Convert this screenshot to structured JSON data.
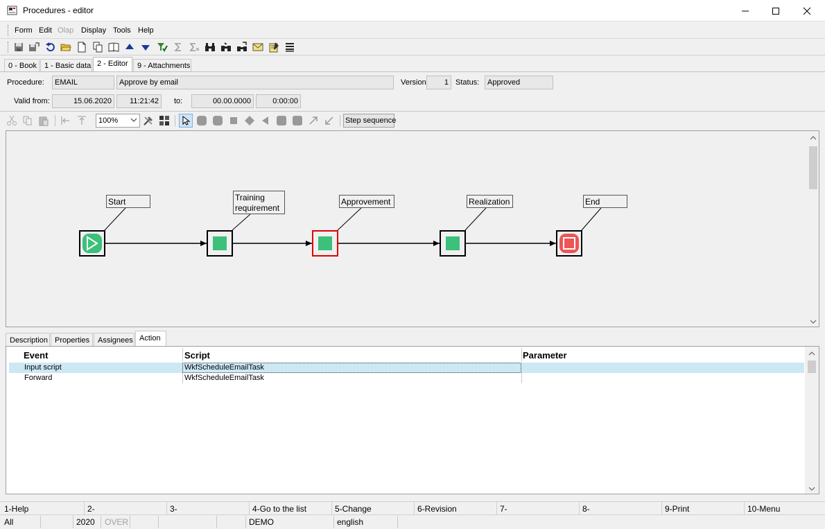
{
  "window": {
    "title": "Procedures - editor"
  },
  "menu": [
    {
      "label": "Form",
      "enabled": true
    },
    {
      "label": "Edit",
      "enabled": true
    },
    {
      "label": "Olap",
      "enabled": false
    },
    {
      "label": "Display",
      "enabled": true
    },
    {
      "label": "Tools",
      "enabled": true
    },
    {
      "label": "Help",
      "enabled": true
    }
  ],
  "toolbar_icons": [
    "save-icon",
    "save-as-icon",
    "undo-icon",
    "open-folder-icon",
    "new-document-icon",
    "copy-document-icon",
    "book-icon",
    "arrow-up-icon",
    "arrow-down-icon",
    "filter-check-icon",
    "sum-icon",
    "subtotal-icon",
    "binoculars-icon",
    "find-next-icon",
    "find-replace-icon",
    "email-icon",
    "notepad-icon",
    "list-icon"
  ],
  "tabs": [
    {
      "label": "0 - Book",
      "active": false
    },
    {
      "label": "1 - Basic data",
      "active": false
    },
    {
      "label": "2 - Editor",
      "active": true
    },
    {
      "label": "9 - Attachments",
      "active": false
    }
  ],
  "form": {
    "procedure_label": "Procedure:",
    "procedure_code": "EMAIL",
    "procedure_name": "Approve by email",
    "version_label": "Version:",
    "version": "1",
    "status_label": "Status:",
    "status": "Approved",
    "valid_from_label": "Valid from:",
    "valid_from_date": "15.06.2020",
    "valid_from_time": "11:21:42",
    "to_label": "to:",
    "to_date": "00.00.0000",
    "to_time": "0:00:00"
  },
  "editor_toolbar": {
    "zoom": "100%",
    "step_sequence_label": "Step sequence"
  },
  "workflow": {
    "nodes": [
      {
        "label": "Start",
        "kind": "start"
      },
      {
        "label": "Training requirement",
        "kind": "task"
      },
      {
        "label": "Approvement",
        "kind": "task",
        "selected": true
      },
      {
        "label": "Realization",
        "kind": "task"
      },
      {
        "label": "End",
        "kind": "end"
      }
    ]
  },
  "lower_tabs": [
    {
      "label": "Description",
      "active": false
    },
    {
      "label": "Properties",
      "active": false
    },
    {
      "label": "Assignees",
      "active": false
    },
    {
      "label": "Action",
      "active": true
    }
  ],
  "grid": {
    "columns": [
      "Event",
      "Script",
      "Parameter"
    ],
    "rows": [
      {
        "event": "Input script",
        "script": "WkfScheduleEmailTask",
        "parameter": "",
        "selected": true
      },
      {
        "event": "Forward",
        "script": "WkfScheduleEmailTask",
        "parameter": "",
        "selected": false
      }
    ]
  },
  "function_keys": [
    "1-Help",
    "2-",
    "3-",
    "4-Go to the list",
    "5-Change",
    "6-Revision",
    "7-",
    "8-",
    "9-Print",
    "10-Menu"
  ],
  "status_bar": {
    "scope": "All",
    "year": "2020",
    "mode": "OVER",
    "database": "DEMO",
    "language": "english"
  }
}
